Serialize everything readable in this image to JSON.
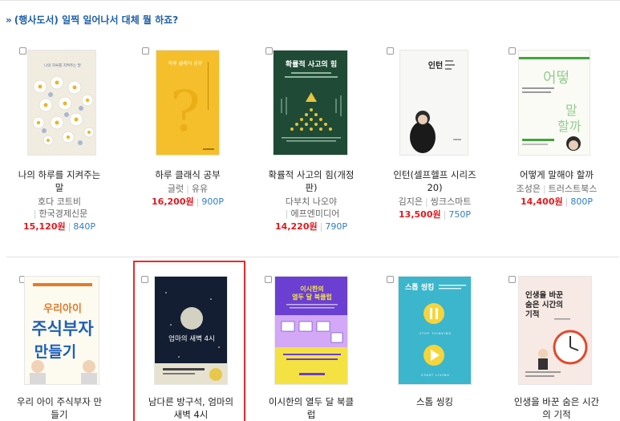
{
  "section": {
    "arrow": "»",
    "title": "(행사도서) 일찍 일어나서 대체 뭘 하죠?"
  },
  "books_row1": [
    {
      "title_lines": [
        "나의 하루를 지켜주는",
        "말"
      ],
      "author": "호다 코트비",
      "publisher": "한국경제신문",
      "price": "15,120원",
      "points": "840P",
      "cover": {
        "bg": "#f1ece0",
        "caption": "나의 하루를 지켜주는 말",
        "accent": "#6a88c4"
      }
    },
    {
      "title_lines": [
        "하루 클래식 공부"
      ],
      "author": "글럿",
      "publisher": "유유",
      "price": "16,200원",
      "points": "900P",
      "cover": {
        "bg": "#f4bf2a",
        "caption": "하루 클래식 공부",
        "accent": "#e6a10a"
      }
    },
    {
      "title_lines": [
        "확률적 사고의 힘(개정",
        "판)"
      ],
      "author": "다부치 나오야",
      "publisher": "에프엔미디어",
      "price": "14,220원",
      "points": "790P",
      "cover": {
        "bg": "#1f4a36",
        "caption": "확률적 사고의 힘",
        "accent": "#e8c33b"
      }
    },
    {
      "title_lines": [
        "인턴(셀프헬프 시리즈",
        "20)"
      ],
      "author": "김지은",
      "publisher": "씽크스마트",
      "price": "13,500원",
      "points": "750P",
      "cover": {
        "bg": "#f7f7f5",
        "caption": "인턴",
        "accent": "#222222"
      }
    },
    {
      "title_lines": [
        "어떻게 말해야 할까"
      ],
      "author": "조성은",
      "publisher": "트러스트북스",
      "price": "14,400원",
      "points": "800P",
      "cover": {
        "bg": "#fbfbf6",
        "caption": "어떻게 말해야 할까",
        "accent": "#3fa63a"
      }
    }
  ],
  "books_row2": [
    {
      "title_lines": [
        "우리 아이 주식부자 만",
        "들기"
      ],
      "cover": {
        "bg": "#fdfbf0",
        "caption": "우리아이 주식부자 만들기",
        "accent": "#1e5fb8"
      }
    },
    {
      "title_lines": [
        "남다른 방구석, 엄마의",
        "새벽 4시"
      ],
      "cover": {
        "bg": "#141e33",
        "caption": "엄마의 새벽 4시",
        "accent": "#e8c84a"
      }
    },
    {
      "title_lines": [
        "이시한의 열두 달 북클",
        "럽"
      ],
      "cover": {
        "bg": "#6a3fd1",
        "caption": "이시한의 열두 달 북클럽",
        "accent": "#f4e243"
      }
    },
    {
      "title_lines": [
        "스톱 씽킹"
      ],
      "cover": {
        "bg": "#3cb6cc",
        "caption": "스톱 씽킹",
        "accent": "#f6d53a"
      }
    },
    {
      "title_lines": [
        "인생을 바꾼 숨은 시간",
        "의 기적"
      ],
      "cover": {
        "bg": "#f7e9e4",
        "caption": "인생을 바꾼 숨은 시간의 기적",
        "accent": "#e04a2e"
      }
    }
  ]
}
